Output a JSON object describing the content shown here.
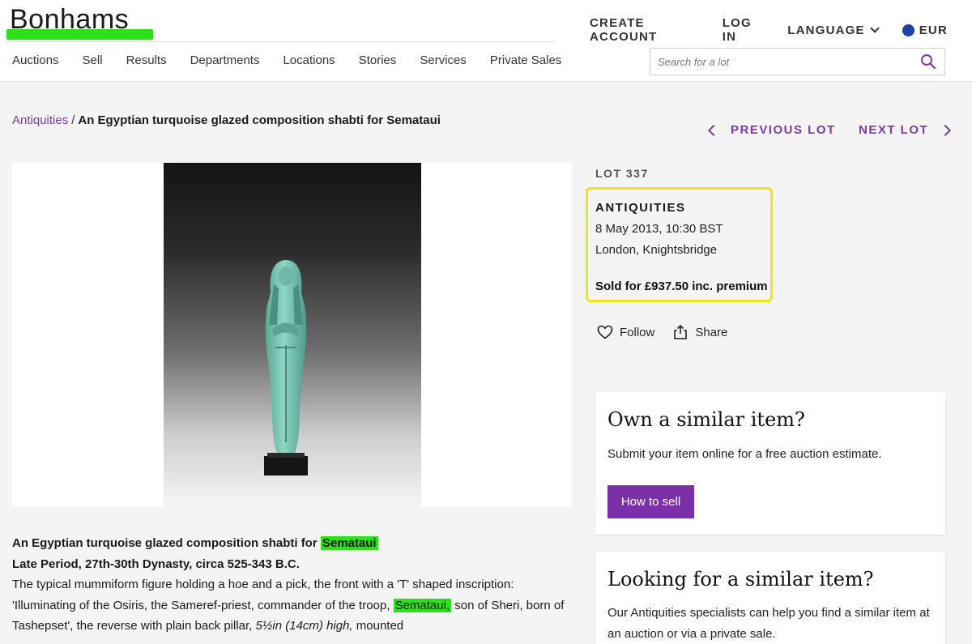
{
  "header": {
    "logo": "Bonhams",
    "top_links": [
      "CREATE ACCOUNT",
      "LOG IN",
      "LANGUAGE",
      "EUR"
    ],
    "nav": [
      "Auctions",
      "Sell",
      "Results",
      "Departments",
      "Locations",
      "Stories",
      "Services",
      "Private Sales"
    ],
    "search_placeholder": "Search for a lot"
  },
  "breadcrumb": {
    "parent": "Antiquities",
    "separator": "/",
    "current": "An Egyptian turquoise glazed composition shabti for Semataui"
  },
  "lot_nav": {
    "previous": "PREVIOUS LOT",
    "next": "NEXT LOT"
  },
  "lot": {
    "number": "LOT 337",
    "department": "ANTIQUITIES",
    "date": "8 May 2013, 10:30 BST",
    "location": "London, Knightsbridge",
    "sold": "Sold for £937.50 inc. premium"
  },
  "actions": {
    "follow": "Follow",
    "share": "Share"
  },
  "card_sell": {
    "title": "Own a similar item?",
    "text": "Submit your item online for a free auction estimate.",
    "button": "How to sell"
  },
  "card_buy": {
    "title": "Looking for a similar item?",
    "text": "Our Antiquities specialists can help you find a similar item at an auction or via a private sale."
  },
  "description": {
    "title_pre": "An Egyptian turquoise glazed composition shabti for ",
    "title_name": "Semataui",
    "period": "Late Period, 27th-30th Dynasty, circa 525-343 B.C.",
    "body_1": "The typical mummiform figure holding a hoe and a pick, the front with a 'T' shaped inscription: 'Illuminating of the Osiris, the Sameref-priest, commander of the troop, ",
    "body_name": "Semataui,",
    "body_2": " son of Sheri, born of Tashepset', the reverse with plain back pillar, ",
    "dimensions": "5½in (14cm) high,",
    "body_3": " mounted"
  },
  "colors": {
    "accent": "#7b3aa8",
    "button": "#7b2fa8",
    "highlight_green": "#2ee01a",
    "highlight_yellow": "#f2e31a"
  }
}
